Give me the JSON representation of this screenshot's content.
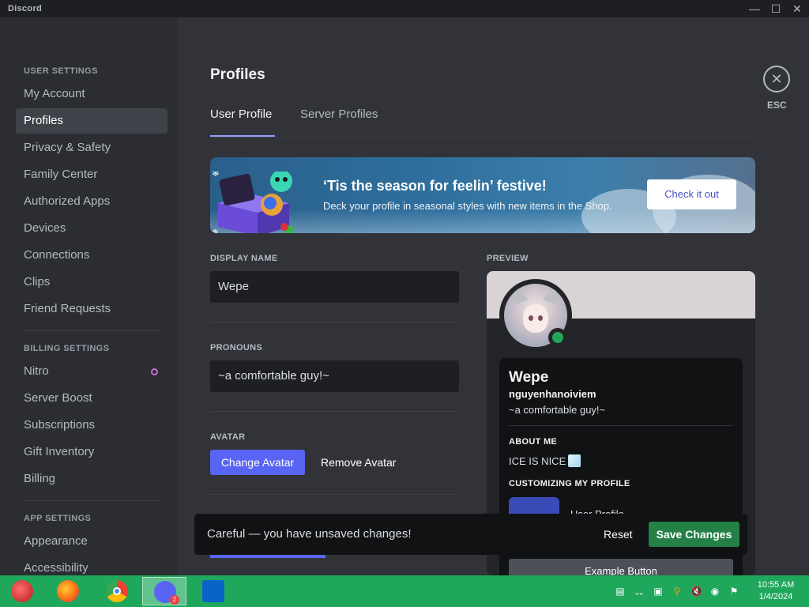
{
  "window": {
    "app_name": "Discord",
    "minimize_icon": "minimize-icon",
    "maximize_icon": "maximize-icon",
    "close_icon": "close-icon"
  },
  "sidebar": {
    "user_settings_header": "USER SETTINGS",
    "user_items": [
      {
        "label": "My Account"
      },
      {
        "label": "Profiles",
        "active": true
      },
      {
        "label": "Privacy & Safety"
      },
      {
        "label": "Family Center"
      },
      {
        "label": "Authorized Apps"
      },
      {
        "label": "Devices"
      },
      {
        "label": "Connections"
      },
      {
        "label": "Clips"
      },
      {
        "label": "Friend Requests"
      }
    ],
    "billing_settings_header": "BILLING SETTINGS",
    "billing_items": [
      {
        "label": "Nitro"
      },
      {
        "label": "Server Boost"
      },
      {
        "label": "Subscriptions"
      },
      {
        "label": "Gift Inventory"
      },
      {
        "label": "Billing"
      }
    ],
    "app_settings_header": "APP SETTINGS",
    "app_items": [
      {
        "label": "Appearance"
      },
      {
        "label": "Accessibility"
      }
    ]
  },
  "main": {
    "title": "Profiles",
    "tabs": [
      {
        "label": "User Profile",
        "active": true
      },
      {
        "label": "Server Profiles"
      }
    ],
    "esc_label": "ESC",
    "banner": {
      "title": "‘Tis the season for feelin’ festive!",
      "subtitle": "Deck your profile in seasonal styles with new items in the Shop.",
      "button": "Check it out"
    },
    "display_name": {
      "label": "DISPLAY NAME",
      "value": "Wepe"
    },
    "pronouns": {
      "label": "PRONOUNS",
      "value": "~a comfortable guy!~"
    },
    "avatar": {
      "label": "AVATAR",
      "change": "Change Avatar",
      "remove": "Remove Avatar"
    },
    "preview": {
      "label": "PREVIEW",
      "name": "Wepe",
      "username": "nguyenhanoiviem",
      "pronouns": "~a comfortable guy!~",
      "about_header": "ABOUT ME",
      "about_text": "ICE IS NICE",
      "customizing_header": "CUSTOMIZING MY PROFILE",
      "customizing_partial": "User Profile",
      "example_button": "Example Button"
    }
  },
  "unsaved_bar": {
    "message": "Careful — you have unsaved changes!",
    "reset": "Reset",
    "save": "Save Changes"
  },
  "taskbar": {
    "apps": [
      {
        "name": "start-orb"
      },
      {
        "name": "firefox"
      },
      {
        "name": "chrome"
      },
      {
        "name": "discord",
        "badge": "2",
        "active": true
      },
      {
        "name": "outlook"
      }
    ],
    "time": "10:55 AM",
    "date": "1/4/2024"
  },
  "colors": {
    "accent": "#5865f2",
    "save_green": "#248046",
    "online_green": "#23a55a",
    "taskbar": "#1fa85c"
  }
}
